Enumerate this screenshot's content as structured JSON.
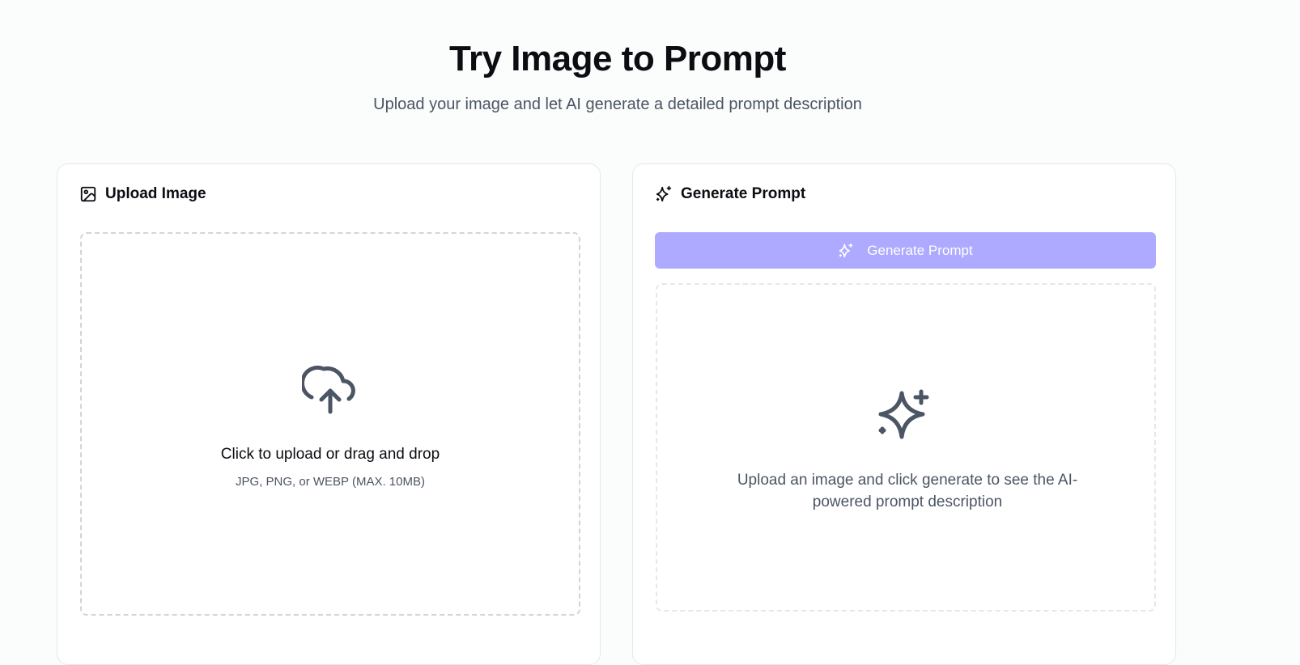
{
  "header": {
    "title": "Try Image to Prompt",
    "subtitle": "Upload your image and let AI generate a detailed prompt description"
  },
  "upload_card": {
    "title": "Upload Image",
    "icon": "image-icon",
    "dropzone": {
      "icon": "cloud-upload-icon",
      "title": "Click to upload or drag and drop",
      "hint": "JPG, PNG, or WEBP (MAX. 10MB)"
    }
  },
  "generate_card": {
    "title": "Generate Prompt",
    "icon": "sparkles-icon",
    "button": {
      "label": "Generate Prompt",
      "icon": "sparkles-icon",
      "state": "disabled",
      "color": "#adaaff"
    },
    "result": {
      "icon": "sparkles-icon",
      "placeholder": "Upload an image and click generate to see the AI-powered prompt description"
    }
  },
  "colors": {
    "background": "#fbfcfc",
    "text_primary": "#0b0d12",
    "text_secondary": "#4b5563",
    "border": "#e5e7eb",
    "accent_disabled": "#adaaff"
  }
}
